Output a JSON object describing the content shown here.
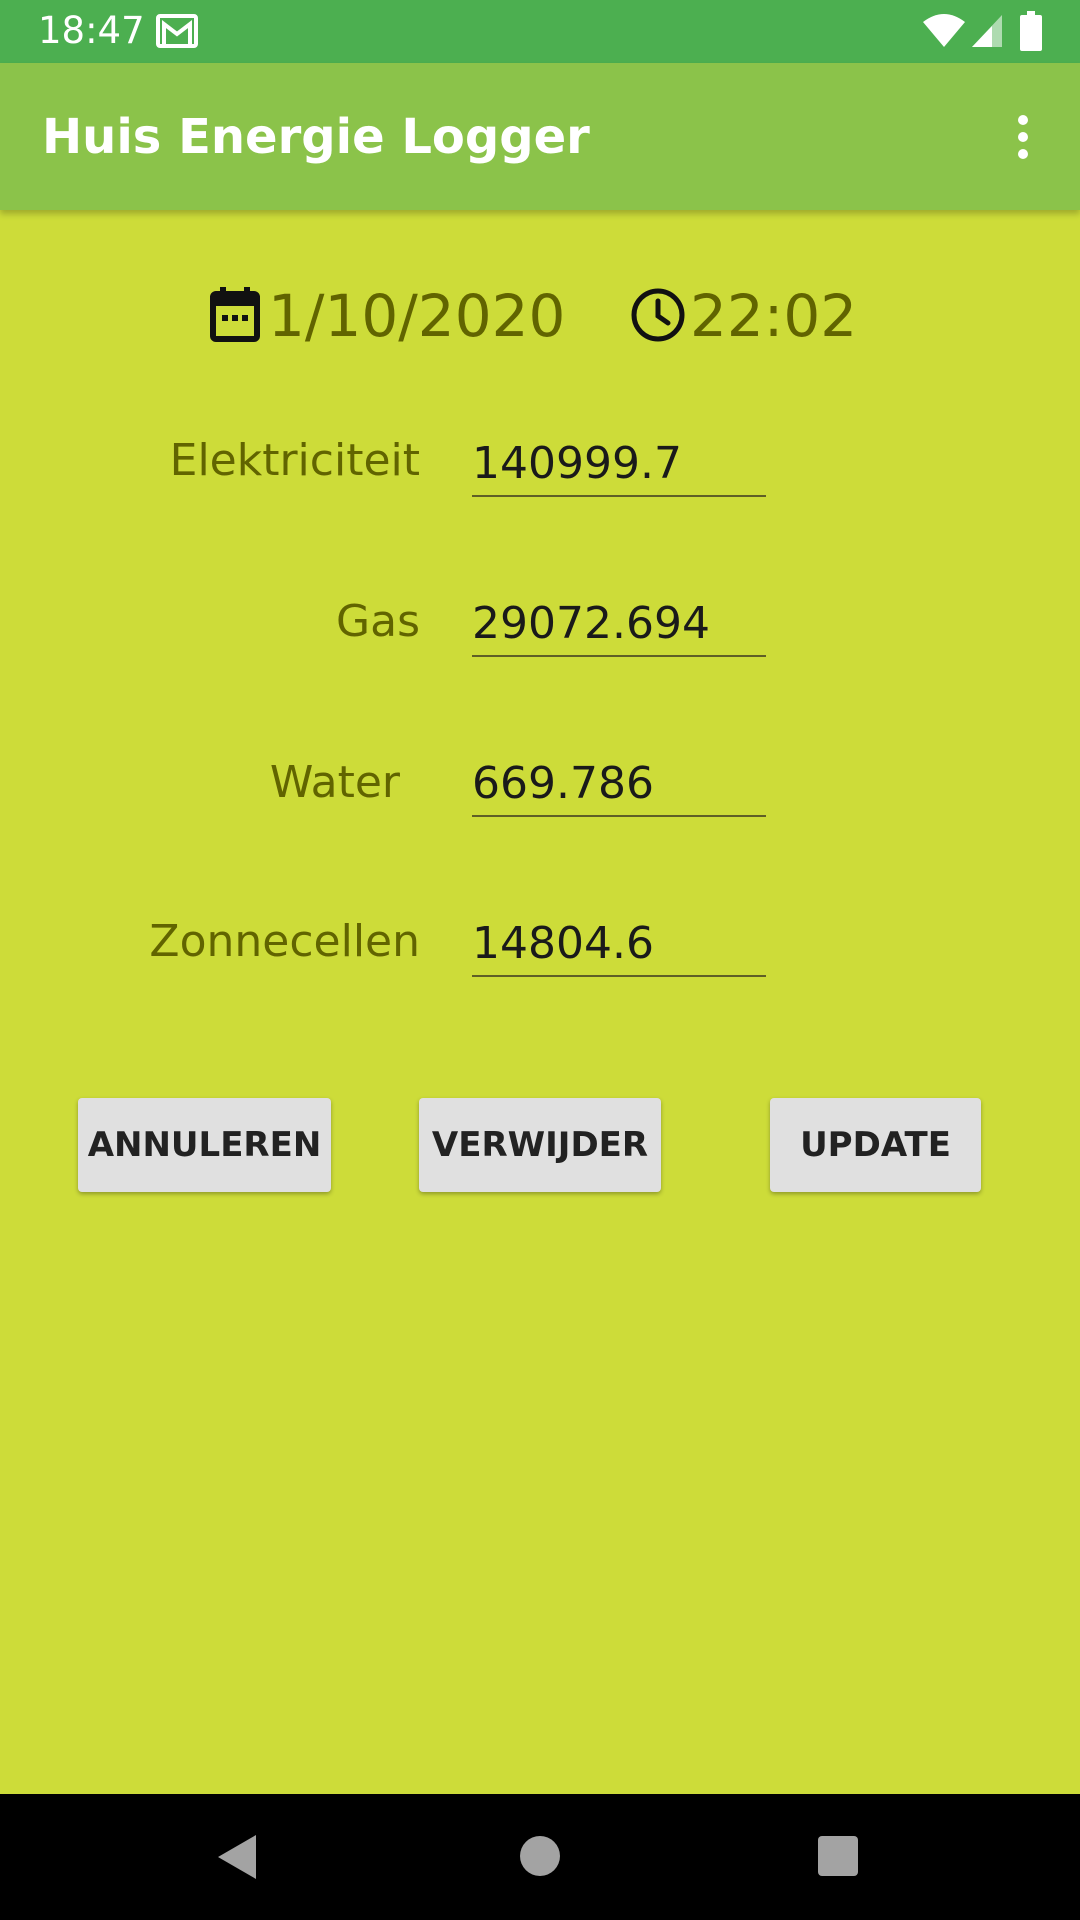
{
  "status_bar": {
    "time": "18:47",
    "icons": [
      "gmail-icon",
      "wifi-icon",
      "signal-icon",
      "battery-icon"
    ]
  },
  "app_bar": {
    "title": "Huis Energie Logger",
    "menu_icon": "more-vert-icon"
  },
  "datetime": {
    "date": "1/10/2020",
    "date_icon": "calendar-icon",
    "time": "22:02",
    "time_icon": "clock-icon"
  },
  "form": {
    "fields": [
      {
        "label": "Elektriciteit",
        "value": "140999.7"
      },
      {
        "label": "Gas",
        "value": "29072.694"
      },
      {
        "label": "Water",
        "value": "669.786"
      },
      {
        "label": "Zonnecellen",
        "value": "14804.6"
      }
    ]
  },
  "buttons": {
    "cancel": "ANNULEREN",
    "delete": "VERWIJDER",
    "update": "UPDATE"
  },
  "nav_bar": {
    "icons": [
      "back-icon",
      "home-icon",
      "recents-icon"
    ]
  },
  "colors": {
    "background": "#CDDC39",
    "app_bar": "#8BC34A",
    "status_bar": "#4CAF50",
    "label_text": "#616400",
    "button": "#E0E0E0"
  }
}
